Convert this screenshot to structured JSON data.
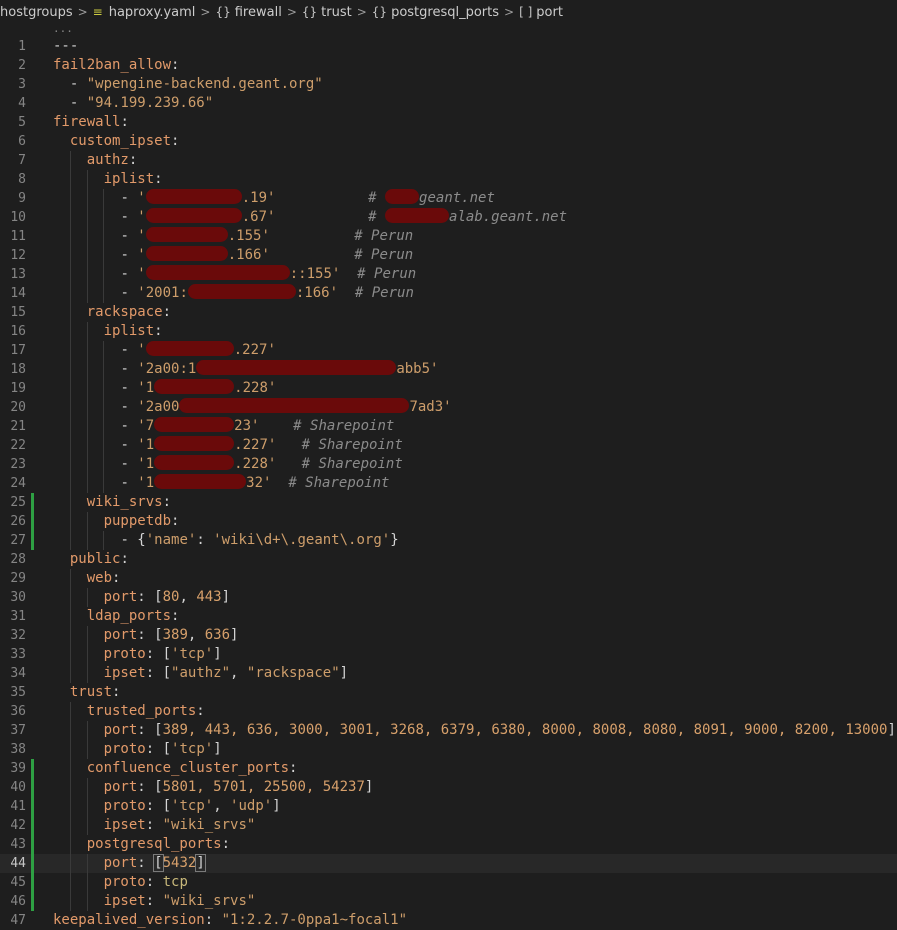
{
  "breadcrumb": {
    "items": [
      {
        "label": "hostgroups",
        "icon": ""
      },
      {
        "label": "haproxy.yaml",
        "icon": "yaml-file-icon"
      },
      {
        "label": "firewall",
        "icon": "{}"
      },
      {
        "label": "trust",
        "icon": "{}"
      },
      {
        "label": "postgresql_ports",
        "icon": "{}"
      },
      {
        "label": "port",
        "icon": "[ ]"
      }
    ],
    "separator": ">"
  },
  "editor": {
    "ellipsis": "...",
    "current_line": 44,
    "lines": [
      {
        "n": "1",
        "indent": 0,
        "t": [
          [
            "pun",
            "---"
          ]
        ]
      },
      {
        "n": "2",
        "indent": 0,
        "t": [
          [
            "key",
            "fail2ban_allow"
          ],
          [
            "pun",
            ":"
          ]
        ]
      },
      {
        "n": "3",
        "indent": 1,
        "t": [
          [
            "dash",
            "- "
          ],
          [
            "str",
            "\"wpengine-backend.geant.org\""
          ]
        ]
      },
      {
        "n": "4",
        "indent": 1,
        "t": [
          [
            "dash",
            "- "
          ],
          [
            "str",
            "\"94.199.239.66\""
          ]
        ]
      },
      {
        "n": "5",
        "indent": 0,
        "t": [
          [
            "key",
            "firewall"
          ],
          [
            "pun",
            ":"
          ]
        ]
      },
      {
        "n": "6",
        "indent": 1,
        "t": [
          [
            "key",
            "custom_ipset"
          ],
          [
            "pun",
            ":"
          ]
        ]
      },
      {
        "n": "7",
        "indent": 2,
        "t": [
          [
            "key",
            "authz"
          ],
          [
            "pun",
            ":"
          ]
        ]
      },
      {
        "n": "8",
        "indent": 3,
        "t": [
          [
            "key",
            "iplist"
          ],
          [
            "pun",
            ":"
          ]
        ]
      },
      {
        "n": "9",
        "indent": 4,
        "t": [
          [
            "dash",
            "- "
          ],
          [
            "str",
            "'"
          ],
          [
            "red",
            "96"
          ],
          [
            "str",
            ".19'"
          ],
          [
            "pun",
            "           "
          ],
          [
            "cmt",
            "# "
          ],
          [
            "red",
            "34"
          ],
          [
            "cmt",
            "geant.net"
          ]
        ]
      },
      {
        "n": "10",
        "indent": 4,
        "t": [
          [
            "dash",
            "- "
          ],
          [
            "str",
            "'"
          ],
          [
            "red",
            "96"
          ],
          [
            "str",
            ".67'"
          ],
          [
            "pun",
            "           "
          ],
          [
            "cmt",
            "# "
          ],
          [
            "red",
            "64"
          ],
          [
            "cmt",
            "alab.geant.net"
          ]
        ]
      },
      {
        "n": "11",
        "indent": 4,
        "t": [
          [
            "dash",
            "- "
          ],
          [
            "str",
            "'"
          ],
          [
            "red",
            "82"
          ],
          [
            "str",
            ".155'"
          ],
          [
            "pun",
            "          "
          ],
          [
            "cmt",
            "# Perun"
          ]
        ]
      },
      {
        "n": "12",
        "indent": 4,
        "t": [
          [
            "dash",
            "- "
          ],
          [
            "str",
            "'"
          ],
          [
            "red",
            "82"
          ],
          [
            "str",
            ".166'"
          ],
          [
            "pun",
            "          "
          ],
          [
            "cmt",
            "# Perun"
          ]
        ]
      },
      {
        "n": "13",
        "indent": 4,
        "t": [
          [
            "dash",
            "- "
          ],
          [
            "str",
            "'"
          ],
          [
            "red",
            "144"
          ],
          [
            "str",
            "::155'"
          ],
          [
            "pun",
            "  "
          ],
          [
            "cmt",
            "# Perun"
          ]
        ]
      },
      {
        "n": "14",
        "indent": 4,
        "t": [
          [
            "dash",
            "- "
          ],
          [
            "str",
            "'2001:"
          ],
          [
            "red",
            "108"
          ],
          [
            "str",
            ":166'"
          ],
          [
            "pun",
            "  "
          ],
          [
            "cmt",
            "# Perun"
          ]
        ]
      },
      {
        "n": "15",
        "indent": 2,
        "t": [
          [
            "key",
            "rackspace"
          ],
          [
            "pun",
            ":"
          ]
        ]
      },
      {
        "n": "16",
        "indent": 3,
        "t": [
          [
            "key",
            "iplist"
          ],
          [
            "pun",
            ":"
          ]
        ]
      },
      {
        "n": "17",
        "indent": 4,
        "t": [
          [
            "dash",
            "- "
          ],
          [
            "str",
            "'"
          ],
          [
            "red",
            "88"
          ],
          [
            "str",
            ".227'"
          ]
        ]
      },
      {
        "n": "18",
        "indent": 4,
        "t": [
          [
            "dash",
            "- "
          ],
          [
            "str",
            "'2a00:1"
          ],
          [
            "red",
            "200"
          ],
          [
            "str",
            "abb5'"
          ]
        ]
      },
      {
        "n": "19",
        "indent": 4,
        "t": [
          [
            "dash",
            "- "
          ],
          [
            "str",
            "'1"
          ],
          [
            "red",
            "80"
          ],
          [
            "str",
            ".228'"
          ]
        ]
      },
      {
        "n": "20",
        "indent": 4,
        "t": [
          [
            "dash",
            "- "
          ],
          [
            "str",
            "'2a00"
          ],
          [
            "red",
            "230"
          ],
          [
            "str",
            "7ad3'"
          ]
        ]
      },
      {
        "n": "21",
        "indent": 4,
        "t": [
          [
            "dash",
            "- "
          ],
          [
            "str",
            "'7"
          ],
          [
            "red",
            "80"
          ],
          [
            "str",
            "23'"
          ],
          [
            "pun",
            "    "
          ],
          [
            "cmt",
            "# Sharepoint"
          ]
        ]
      },
      {
        "n": "22",
        "indent": 4,
        "t": [
          [
            "dash",
            "- "
          ],
          [
            "str",
            "'1"
          ],
          [
            "red",
            "80"
          ],
          [
            "str",
            ".227'"
          ],
          [
            "pun",
            "   "
          ],
          [
            "cmt",
            "# Sharepoint"
          ]
        ]
      },
      {
        "n": "23",
        "indent": 4,
        "t": [
          [
            "dash",
            "- "
          ],
          [
            "str",
            "'1"
          ],
          [
            "red",
            "80"
          ],
          [
            "str",
            ".228'"
          ],
          [
            "pun",
            "   "
          ],
          [
            "cmt",
            "# Sharepoint"
          ]
        ]
      },
      {
        "n": "24",
        "indent": 4,
        "t": [
          [
            "dash",
            "- "
          ],
          [
            "str",
            "'1"
          ],
          [
            "red",
            "92"
          ],
          [
            "str",
            "32'"
          ],
          [
            "pun",
            "  "
          ],
          [
            "cmt",
            "# Sharepoint"
          ]
        ]
      },
      {
        "n": "25",
        "indent": 2,
        "mark": true,
        "t": [
          [
            "key",
            "wiki_srvs"
          ],
          [
            "pun",
            ":"
          ]
        ]
      },
      {
        "n": "26",
        "indent": 3,
        "mark": true,
        "t": [
          [
            "key",
            "puppetdb"
          ],
          [
            "pun",
            ":"
          ]
        ]
      },
      {
        "n": "27",
        "indent": 4,
        "mark": true,
        "t": [
          [
            "dash",
            "- "
          ],
          [
            "pun",
            "{"
          ],
          [
            "str",
            "'name'"
          ],
          [
            "pun",
            ": "
          ],
          [
            "str",
            "'wiki\\d+\\.geant\\.org'"
          ],
          [
            "pun",
            "}"
          ]
        ]
      },
      {
        "n": "28",
        "indent": 1,
        "t": [
          [
            "key",
            "public"
          ],
          [
            "pun",
            ":"
          ]
        ]
      },
      {
        "n": "29",
        "indent": 2,
        "t": [
          [
            "key",
            "web"
          ],
          [
            "pun",
            ":"
          ]
        ]
      },
      {
        "n": "30",
        "indent": 3,
        "t": [
          [
            "key",
            "port"
          ],
          [
            "pun",
            ": ["
          ],
          [
            "num",
            "80"
          ],
          [
            "pun",
            ", "
          ],
          [
            "num",
            "443"
          ],
          [
            "pun",
            "]"
          ]
        ]
      },
      {
        "n": "31",
        "indent": 2,
        "t": [
          [
            "key",
            "ldap_ports"
          ],
          [
            "pun",
            ":"
          ]
        ]
      },
      {
        "n": "32",
        "indent": 3,
        "t": [
          [
            "key",
            "port"
          ],
          [
            "pun",
            ": ["
          ],
          [
            "num",
            "389"
          ],
          [
            "pun",
            ", "
          ],
          [
            "num",
            "636"
          ],
          [
            "pun",
            "]"
          ]
        ]
      },
      {
        "n": "33",
        "indent": 3,
        "t": [
          [
            "key",
            "proto"
          ],
          [
            "pun",
            ": ["
          ],
          [
            "str",
            "'tcp'"
          ],
          [
            "pun",
            "]"
          ]
        ]
      },
      {
        "n": "34",
        "indent": 3,
        "t": [
          [
            "key",
            "ipset"
          ],
          [
            "pun",
            ": ["
          ],
          [
            "str",
            "\"authz\""
          ],
          [
            "pun",
            ", "
          ],
          [
            "str",
            "\"rackspace\""
          ],
          [
            "pun",
            "]"
          ]
        ]
      },
      {
        "n": "35",
        "indent": 1,
        "t": [
          [
            "key",
            "trust"
          ],
          [
            "pun",
            ":"
          ]
        ]
      },
      {
        "n": "36",
        "indent": 2,
        "t": [
          [
            "key",
            "trusted_ports"
          ],
          [
            "pun",
            ":"
          ]
        ]
      },
      {
        "n": "37",
        "indent": 3,
        "t": [
          [
            "key",
            "port"
          ],
          [
            "pun",
            ": ["
          ],
          [
            "num",
            "389, 443, 636, 3000, 3001, 3268, 6379, 6380, 8000, 8008, 8080, 8091, 9000, 8200, 13000"
          ],
          [
            "pun",
            "]"
          ]
        ]
      },
      {
        "n": "38",
        "indent": 3,
        "t": [
          [
            "key",
            "proto"
          ],
          [
            "pun",
            ": ["
          ],
          [
            "str",
            "'tcp'"
          ],
          [
            "pun",
            "]"
          ]
        ]
      },
      {
        "n": "39",
        "indent": 2,
        "mark": true,
        "t": [
          [
            "key",
            "confluence_cluster_ports"
          ],
          [
            "pun",
            ":"
          ]
        ]
      },
      {
        "n": "40",
        "indent": 3,
        "mark": true,
        "t": [
          [
            "key",
            "port"
          ],
          [
            "pun",
            ": ["
          ],
          [
            "num",
            "5801, 5701, 25500, 54237"
          ],
          [
            "pun",
            "]"
          ]
        ]
      },
      {
        "n": "41",
        "indent": 3,
        "mark": true,
        "t": [
          [
            "key",
            "proto"
          ],
          [
            "pun",
            ": ["
          ],
          [
            "str",
            "'tcp'"
          ],
          [
            "pun",
            ", "
          ],
          [
            "str",
            "'udp'"
          ],
          [
            "pun",
            "]"
          ]
        ]
      },
      {
        "n": "42",
        "indent": 3,
        "mark": true,
        "t": [
          [
            "key",
            "ipset"
          ],
          [
            "pun",
            ": "
          ],
          [
            "str",
            "\"wiki_srvs\""
          ]
        ]
      },
      {
        "n": "43",
        "indent": 2,
        "mark": true,
        "t": [
          [
            "key",
            "postgresql_ports"
          ],
          [
            "pun",
            ":"
          ]
        ]
      },
      {
        "n": "44",
        "indent": 3,
        "mark": true,
        "t": [
          [
            "key",
            "port"
          ],
          [
            "pun",
            ": "
          ],
          [
            "hl",
            "["
          ],
          [
            "num",
            "5432"
          ],
          [
            "hl",
            "]"
          ]
        ]
      },
      {
        "n": "45",
        "indent": 3,
        "mark": true,
        "t": [
          [
            "key",
            "proto"
          ],
          [
            "pun",
            ": "
          ],
          [
            "str2",
            "tcp"
          ]
        ]
      },
      {
        "n": "46",
        "indent": 3,
        "mark": true,
        "t": [
          [
            "key",
            "ipset"
          ],
          [
            "pun",
            ": "
          ],
          [
            "str",
            "\"wiki_srvs\""
          ]
        ]
      },
      {
        "n": "47",
        "indent": 0,
        "t": [
          [
            "key",
            "keepalived_version"
          ],
          [
            "pun",
            ": "
          ],
          [
            "str",
            "\"1:2.2.7-0ppa1~focal1\""
          ]
        ]
      }
    ]
  }
}
